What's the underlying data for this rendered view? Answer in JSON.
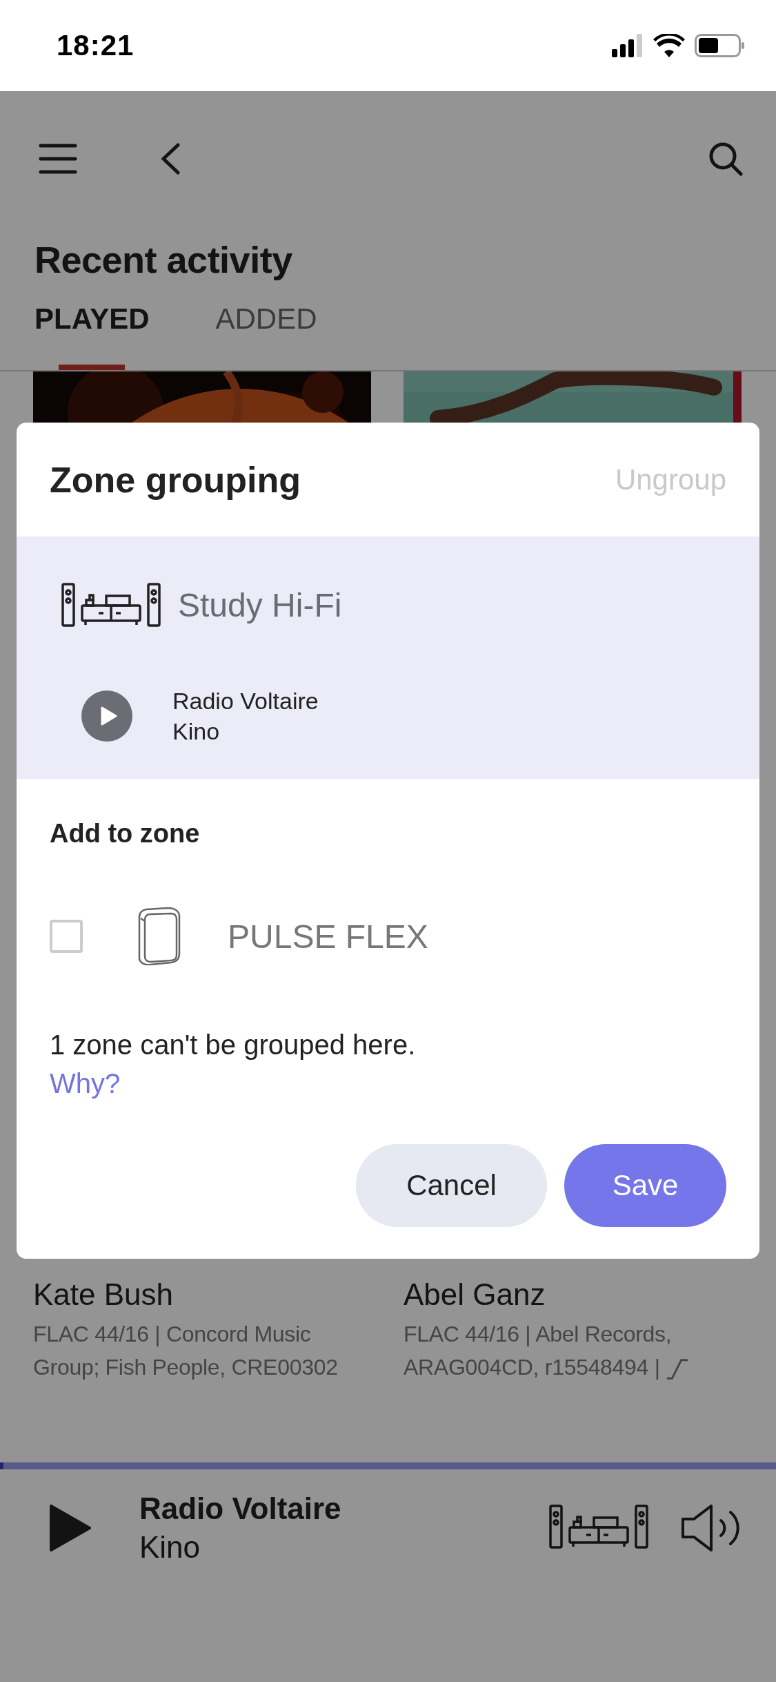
{
  "status_bar": {
    "time": "18:21"
  },
  "header": {
    "title": "Recent activity"
  },
  "tabs": [
    {
      "label": "PLAYED",
      "selected": true
    },
    {
      "label": "ADDED",
      "selected": false
    }
  ],
  "albums": [
    {
      "artist": "Kate Bush",
      "details": "FLAC 44/16 | Concord Music Group; Fish People, CRE00302",
      "hires": false
    },
    {
      "artist": "Abel Ganz",
      "details": "FLAC 44/16 | Abel Records, ARAG004CD, r15548494 |",
      "hires": true
    }
  ],
  "now_playing": {
    "title": "Radio Voltaire",
    "subtitle": "Kino",
    "progress": {
      "level": 0.004
    }
  },
  "dialog": {
    "title": "Zone grouping",
    "ungroup": "Ungroup",
    "current_zone": {
      "name": "Study Hi-Fi",
      "track": "Radio Voltaire",
      "station": "Kino"
    },
    "add_heading": "Add to zone",
    "zones": [
      {
        "name": "PULSE FLEX",
        "checked": false
      }
    ],
    "note": "1 zone can't be grouped here.",
    "link": "Why?",
    "buttons": [
      {
        "label": "Cancel",
        "kind": "secondary"
      },
      {
        "label": "Save",
        "kind": "primary"
      }
    ]
  }
}
